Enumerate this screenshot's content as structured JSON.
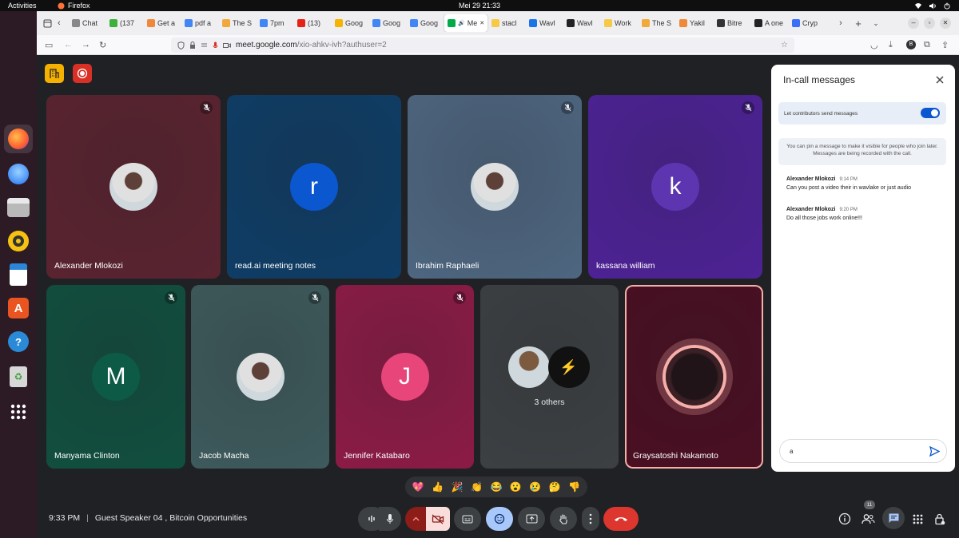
{
  "os": {
    "activities": "Activities",
    "app_name": "Firefox",
    "clock": "Mei 29  21:33"
  },
  "browser": {
    "tabs": [
      {
        "label": "Chat",
        "color": "#888888"
      },
      {
        "label": "(137",
        "color": "#3eb03e"
      },
      {
        "label": "Get a",
        "color": "#f0883a"
      },
      {
        "label": "pdf a",
        "color": "#4285f4"
      },
      {
        "label": "The S",
        "color": "#f2a93b"
      },
      {
        "label": "7pm",
        "color": "#4285f4"
      },
      {
        "label": "(13)",
        "color": "#e62117"
      },
      {
        "label": "Goog",
        "color": "#f4b400"
      },
      {
        "label": "Goog",
        "color": "#4285f4"
      },
      {
        "label": "Goog",
        "color": "#4285f4"
      },
      {
        "label": "Me",
        "color": "#00ac47",
        "active": true
      },
      {
        "label": "stacl",
        "color": "#f7c948"
      },
      {
        "label": "Wavl",
        "color": "#1a73e8"
      },
      {
        "label": "Wavl",
        "color": "#222222"
      },
      {
        "label": "Work",
        "color": "#f7c948"
      },
      {
        "label": "The S",
        "color": "#f2a93b"
      },
      {
        "label": "Yakil",
        "color": "#f0883a"
      },
      {
        "label": "Bitre",
        "color": "#333333"
      },
      {
        "label": "A one",
        "color": "#222222"
      },
      {
        "label": "Cryp",
        "color": "#3d6ef7"
      }
    ],
    "url_host": "meet.google.com",
    "url_path": "/xio-ahkv-ivh?authuser=2"
  },
  "participants": [
    {
      "name": "Alexander Mlokozi",
      "bg": "#5a2330",
      "muted": true,
      "avatar": "photo"
    },
    {
      "name": "read.ai meeting notes",
      "bg": "#0f3d66",
      "muted": false,
      "avatar": "r"
    },
    {
      "name": "Ibrahim Raphaeli",
      "bg": "#4e6680",
      "muted": true,
      "avatar": "photo"
    },
    {
      "name": "kassana william",
      "bg": "#4d2295",
      "muted": true,
      "avatar": "k"
    },
    {
      "name": "Manyama Clinton",
      "bg": "#114f3f",
      "muted": true,
      "avatar": "M"
    },
    {
      "name": "Jacob Macha",
      "bg": "#3e5a5c",
      "muted": true,
      "avatar": "photo"
    },
    {
      "name": "Jennifer Katabaro",
      "bg": "#8c1b45",
      "muted": true,
      "avatar": "J"
    },
    {
      "name": "3 others",
      "bg": "#3c4043",
      "muted": false,
      "avatar": "group"
    },
    {
      "name": "Graysatoshi Nakamoto",
      "bg": "#4a0f22",
      "muted": false,
      "avatar": "photo",
      "speaking": true
    }
  ],
  "chat": {
    "title": "In-call messages",
    "toggle_label": "Let contributors send messages",
    "toggle_on": true,
    "pin_note": "You can pin a message to make it visible for people who join later. Messages are being recorded with the call.",
    "messages": [
      {
        "sender": "Alexander Mlokozi",
        "time": "9:14 PM",
        "text": "Can you post a video their in wavlake or just audio"
      },
      {
        "sender": "Alexander Mlokozi",
        "time": "9:20 PM",
        "text": "Do all those jobs work online!!!"
      }
    ],
    "input_value": "a"
  },
  "reactions": [
    "💖",
    "👍",
    "🎉",
    "👏",
    "😂",
    "😮",
    "😢",
    "🤔",
    "👎"
  ],
  "footer": {
    "time": "9:33 PM",
    "separator": "|",
    "meeting_title": "Guest Speaker 04 , Bitcoin Opportunities",
    "people_count": "11"
  }
}
